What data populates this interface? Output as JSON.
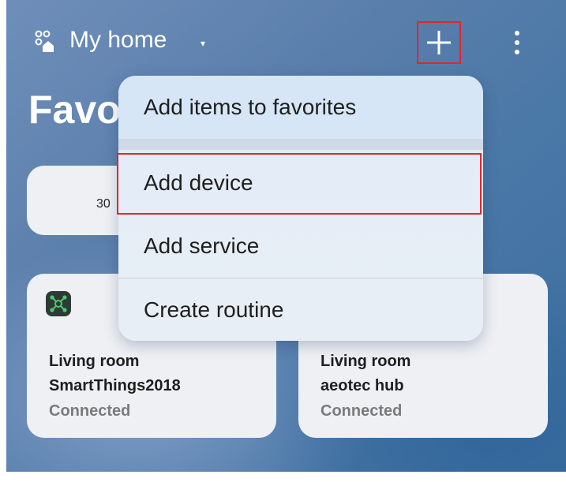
{
  "header": {
    "home_title": "My home",
    "caret": "▾",
    "add_icon": "plus-icon",
    "more_icon": "more-vertical-icon"
  },
  "page": {
    "heading": "Favorites",
    "small_tile_text": "30"
  },
  "menu": {
    "items": [
      {
        "label": "Add items to favorites"
      },
      {
        "label": "Add device"
      },
      {
        "label": "Add service"
      },
      {
        "label": "Create routine"
      }
    ]
  },
  "cards": [
    {
      "room": "Living room",
      "name": "SmartThings2018",
      "status": "Connected",
      "icon": "hub-icon"
    },
    {
      "room": "Living room",
      "name": "aeotec hub",
      "status": "Connected"
    }
  ],
  "colors": {
    "highlight": "#e2252b",
    "card_bg": "#eef0f4",
    "hub_icon_bg": "#2d3a35",
    "hub_icon_fg": "#4cc96b"
  }
}
